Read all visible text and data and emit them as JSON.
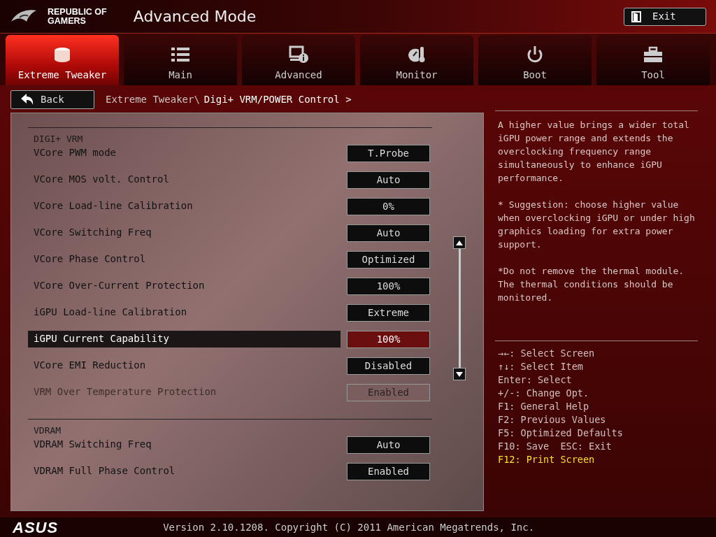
{
  "header": {
    "brand": [
      "REPUBLIC OF",
      "GAMERS"
    ],
    "title": "Advanced Mode",
    "exit_button": "Exit"
  },
  "tabs": [
    {
      "label": "Extreme Tweaker",
      "kind": "tweaker",
      "selected": true
    },
    {
      "label": "Main",
      "kind": "list",
      "selected": false
    },
    {
      "label": "Advanced",
      "kind": "advanced",
      "selected": false
    },
    {
      "label": "Monitor",
      "kind": "monitor",
      "selected": false
    },
    {
      "label": "Boot",
      "kind": "power",
      "selected": false
    },
    {
      "label": "Tool",
      "kind": "tool",
      "selected": false
    }
  ],
  "back_button": "Back",
  "breadcrumb": {
    "parent": "Extreme Tweaker\\",
    "current": "Digi+ VRM/POWER Control >"
  },
  "sections": [
    {
      "title": "DIGI+ VRM",
      "rows": [
        {
          "label": "VCore PWM mode",
          "value": "T.Probe",
          "selected": false,
          "disabled": false
        },
        {
          "label": "VCore MOS volt. Control",
          "value": "Auto",
          "selected": false,
          "disabled": false
        },
        {
          "label": "VCore Load-line Calibration",
          "value": "0%",
          "selected": false,
          "disabled": false
        },
        {
          "label": "VCore Switching Freq",
          "value": "Auto",
          "selected": false,
          "disabled": false
        },
        {
          "label": "VCore Phase Control",
          "value": "Optimized",
          "selected": false,
          "disabled": false
        },
        {
          "label": "VCore Over-Current Protection",
          "value": "100%",
          "selected": false,
          "disabled": false
        },
        {
          "label": "iGPU Load-line Calibration",
          "value": "Extreme",
          "selected": false,
          "disabled": false
        },
        {
          "label": "iGPU Current Capability",
          "value": "100%",
          "selected": true,
          "disabled": false
        },
        {
          "label": "VCore EMI Reduction",
          "value": "Disabled",
          "selected": false,
          "disabled": false
        },
        {
          "label": "VRM Over Temperature Protection",
          "value": "Enabled",
          "selected": false,
          "disabled": true
        }
      ]
    },
    {
      "title": "VDRAM",
      "rows": [
        {
          "label": "VDRAM Switching Freq",
          "value": "Auto",
          "selected": false,
          "disabled": false
        },
        {
          "label": "VDRAM Full Phase Control",
          "value": "Enabled",
          "selected": false,
          "disabled": false
        }
      ]
    }
  ],
  "help": [
    "A higher value brings a wider total iGPU power range and extends the overclocking frequency range simultaneously to enhance iGPU performance.",
    "* Suggestion: choose higher value when overclocking iGPU or under high graphics loading for extra power support.",
    "*Do not remove the thermal module. The thermal conditions should be monitored."
  ],
  "key_hints": [
    {
      "text": "→←: Select Screen",
      "highlighted": false
    },
    {
      "text": "↑↓: Select Item",
      "highlighted": false
    },
    {
      "text": "Enter: Select",
      "highlighted": false
    },
    {
      "text": "+/-: Change Opt.",
      "highlighted": false
    },
    {
      "text": "F1: General Help",
      "highlighted": false
    },
    {
      "text": "F2: Previous Values",
      "highlighted": false
    },
    {
      "text": "F5: Optimized Defaults",
      "highlighted": false
    },
    {
      "text": "F10: Save  ESC: Exit",
      "highlighted": false
    },
    {
      "text": "F12: Print Screen",
      "highlighted": true
    }
  ],
  "footer": {
    "logo": "ASUS",
    "version": "Version 2.10.1208. Copyright (C) 2011 American Megatrends, Inc."
  }
}
